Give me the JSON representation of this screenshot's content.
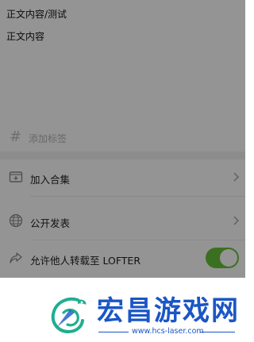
{
  "editor": {
    "line1": "正文内容/测试",
    "line2": "正文内容"
  },
  "tags": {
    "icon": "hash-icon",
    "placeholder": "添加标签"
  },
  "options": {
    "add_collection": {
      "icon": "collection-icon",
      "label": "加入合集"
    },
    "publish": {
      "icon": "globe-icon",
      "label": "公开发表"
    },
    "repost": {
      "icon": "share-icon",
      "label": "允许他人转载至 LOFTER",
      "toggle_on": true
    }
  },
  "colors": {
    "toggle_on": "#66c23a",
    "overlay": "rgba(0,0,0,0.42)",
    "brand_blue": "#1a56c6",
    "logo_green": "#1fae8f"
  },
  "banner": {
    "brand": "宏昌游戏网",
    "site": "www.hcs-laser.com",
    "logo_icon": "dragon-logo"
  }
}
